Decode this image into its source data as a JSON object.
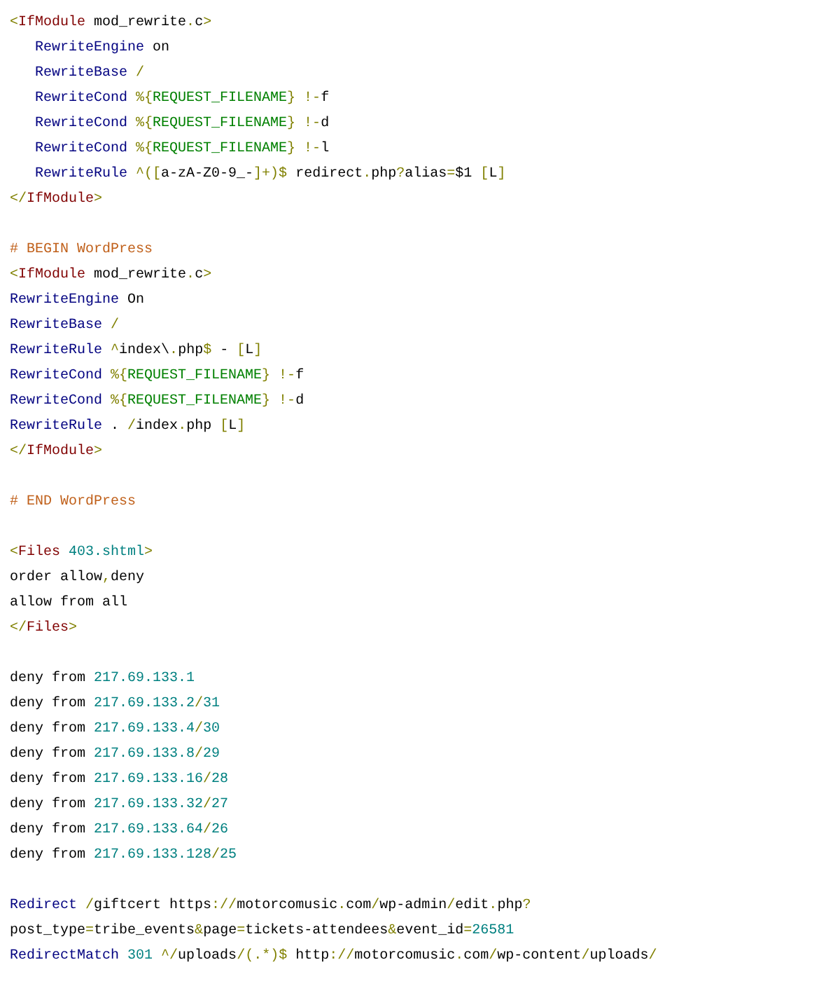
{
  "blocks": [
    {
      "lines": [
        {
          "tokens": [
            {
              "kind": "punct",
              "text": "<"
            },
            {
              "kind": "tag",
              "text": "IfModule"
            },
            {
              "kind": "plain",
              "text": " mod_rewrite"
            },
            {
              "kind": "punct",
              "text": "."
            },
            {
              "kind": "plain",
              "text": "c"
            },
            {
              "kind": "punct",
              "text": ">"
            }
          ],
          "children": [
            {
              "tokens": [
                {
                  "kind": "directive",
                  "text": "RewriteEngine"
                },
                {
                  "kind": "plain",
                  "text": " on"
                }
              ]
            },
            {
              "tokens": [
                {
                  "kind": "directive",
                  "text": "RewriteBase"
                },
                {
                  "kind": "punct",
                  "text": " /"
                }
              ]
            },
            {
              "tokens": [
                {
                  "kind": "directive",
                  "text": "RewriteCond"
                },
                {
                  "kind": "punct",
                  "text": " %{"
                },
                {
                  "kind": "variable",
                  "text": "REQUEST_FILENAME"
                },
                {
                  "kind": "punct",
                  "text": "} !-"
                },
                {
                  "kind": "plain",
                  "text": "f"
                }
              ]
            },
            {
              "tokens": [
                {
                  "kind": "directive",
                  "text": "RewriteCond"
                },
                {
                  "kind": "punct",
                  "text": " %{"
                },
                {
                  "kind": "variable",
                  "text": "REQUEST_FILENAME"
                },
                {
                  "kind": "punct",
                  "text": "} !-"
                },
                {
                  "kind": "plain",
                  "text": "d"
                }
              ]
            },
            {
              "tokens": [
                {
                  "kind": "directive",
                  "text": "RewriteCond"
                },
                {
                  "kind": "punct",
                  "text": " %{"
                },
                {
                  "kind": "variable",
                  "text": "REQUEST_FILENAME"
                },
                {
                  "kind": "punct",
                  "text": "} !-"
                },
                {
                  "kind": "plain",
                  "text": "l"
                }
              ]
            },
            {
              "tokens": [
                {
                  "kind": "directive",
                  "text": "RewriteRule"
                },
                {
                  "kind": "punct",
                  "text": " ^(["
                },
                {
                  "kind": "plain",
                  "text": "a-zA-Z0-9_-"
                },
                {
                  "kind": "punct",
                  "text": "]+)$"
                },
                {
                  "kind": "plain",
                  "text": " redirect"
                },
                {
                  "kind": "punct",
                  "text": "."
                },
                {
                  "kind": "plain",
                  "text": "php"
                },
                {
                  "kind": "punct",
                  "text": "?"
                },
                {
                  "kind": "plain",
                  "text": "alias"
                },
                {
                  "kind": "punct",
                  "text": "="
                },
                {
                  "kind": "plain",
                  "text": "$1"
                },
                {
                  "kind": "punct",
                  "text": " ["
                },
                {
                  "kind": "plain",
                  "text": "L"
                },
                {
                  "kind": "punct",
                  "text": "]"
                }
              ]
            }
          ]
        },
        {
          "tokens": [
            {
              "kind": "punct",
              "text": "</"
            },
            {
              "kind": "tag",
              "text": "IfModule"
            },
            {
              "kind": "punct",
              "text": ">"
            }
          ]
        }
      ]
    },
    {
      "lines": [
        {
          "tokens": [
            {
              "kind": "comment",
              "text": "# BEGIN WordPress"
            }
          ]
        },
        {
          "tokens": [
            {
              "kind": "punct",
              "text": "<"
            },
            {
              "kind": "tag",
              "text": "IfModule"
            },
            {
              "kind": "plain",
              "text": " mod_rewrite"
            },
            {
              "kind": "punct",
              "text": "."
            },
            {
              "kind": "plain",
              "text": "c"
            },
            {
              "kind": "punct",
              "text": ">"
            }
          ]
        },
        {
          "tokens": [
            {
              "kind": "directive",
              "text": "RewriteEngine"
            },
            {
              "kind": "plain",
              "text": " On"
            }
          ]
        },
        {
          "tokens": [
            {
              "kind": "directive",
              "text": "RewriteBase"
            },
            {
              "kind": "punct",
              "text": " /"
            }
          ]
        },
        {
          "tokens": [
            {
              "kind": "directive",
              "text": "RewriteRule"
            },
            {
              "kind": "punct",
              "text": " ^"
            },
            {
              "kind": "plain",
              "text": "index\\"
            },
            {
              "kind": "punct",
              "text": "."
            },
            {
              "kind": "plain",
              "text": "php"
            },
            {
              "kind": "punct",
              "text": "$"
            },
            {
              "kind": "plain",
              "text": " -"
            },
            {
              "kind": "punct",
              "text": " ["
            },
            {
              "kind": "plain",
              "text": "L"
            },
            {
              "kind": "punct",
              "text": "]"
            }
          ]
        },
        {
          "tokens": [
            {
              "kind": "directive",
              "text": "RewriteCond"
            },
            {
              "kind": "punct",
              "text": " %{"
            },
            {
              "kind": "variable",
              "text": "REQUEST_FILENAME"
            },
            {
              "kind": "punct",
              "text": "} !-"
            },
            {
              "kind": "plain",
              "text": "f"
            }
          ]
        },
        {
          "tokens": [
            {
              "kind": "directive",
              "text": "RewriteCond"
            },
            {
              "kind": "punct",
              "text": " %{"
            },
            {
              "kind": "variable",
              "text": "REQUEST_FILENAME"
            },
            {
              "kind": "punct",
              "text": "} !-"
            },
            {
              "kind": "plain",
              "text": "d"
            }
          ]
        },
        {
          "tokens": [
            {
              "kind": "directive",
              "text": "RewriteRule"
            },
            {
              "kind": "plain",
              "text": " ."
            },
            {
              "kind": "punct",
              "text": " /"
            },
            {
              "kind": "plain",
              "text": "index"
            },
            {
              "kind": "punct",
              "text": "."
            },
            {
              "kind": "plain",
              "text": "php"
            },
            {
              "kind": "punct",
              "text": " ["
            },
            {
              "kind": "plain",
              "text": "L"
            },
            {
              "kind": "punct",
              "text": "]"
            }
          ]
        },
        {
          "tokens": [
            {
              "kind": "punct",
              "text": "</"
            },
            {
              "kind": "tag",
              "text": "IfModule"
            },
            {
              "kind": "punct",
              "text": ">"
            }
          ]
        }
      ]
    },
    {
      "lines": [
        {
          "tokens": [
            {
              "kind": "comment",
              "text": "# END WordPress"
            }
          ]
        }
      ]
    },
    {
      "lines": [
        {
          "tokens": [
            {
              "kind": "punct",
              "text": "<"
            },
            {
              "kind": "tag",
              "text": "Files"
            },
            {
              "kind": "number",
              "text": " 403.shtml"
            },
            {
              "kind": "punct",
              "text": ">"
            }
          ]
        },
        {
          "tokens": [
            {
              "kind": "plain",
              "text": "order allow"
            },
            {
              "kind": "punct",
              "text": ","
            },
            {
              "kind": "plain",
              "text": "deny"
            }
          ]
        },
        {
          "tokens": [
            {
              "kind": "plain",
              "text": "allow from all"
            }
          ]
        },
        {
          "tokens": [
            {
              "kind": "punct",
              "text": "</"
            },
            {
              "kind": "tag",
              "text": "Files"
            },
            {
              "kind": "punct",
              "text": ">"
            }
          ]
        }
      ]
    },
    {
      "lines": [
        {
          "tokens": [
            {
              "kind": "plain",
              "text": "deny from"
            },
            {
              "kind": "number",
              "text": " 217.69.133.1"
            }
          ]
        },
        {
          "tokens": [
            {
              "kind": "plain",
              "text": "deny from"
            },
            {
              "kind": "number",
              "text": " 217.69.133.2"
            },
            {
              "kind": "punct",
              "text": "/"
            },
            {
              "kind": "number",
              "text": "31"
            }
          ]
        },
        {
          "tokens": [
            {
              "kind": "plain",
              "text": "deny from"
            },
            {
              "kind": "number",
              "text": " 217.69.133.4"
            },
            {
              "kind": "punct",
              "text": "/"
            },
            {
              "kind": "number",
              "text": "30"
            }
          ]
        },
        {
          "tokens": [
            {
              "kind": "plain",
              "text": "deny from"
            },
            {
              "kind": "number",
              "text": " 217.69.133.8"
            },
            {
              "kind": "punct",
              "text": "/"
            },
            {
              "kind": "number",
              "text": "29"
            }
          ]
        },
        {
          "tokens": [
            {
              "kind": "plain",
              "text": "deny from"
            },
            {
              "kind": "number",
              "text": " 217.69.133.16"
            },
            {
              "kind": "punct",
              "text": "/"
            },
            {
              "kind": "number",
              "text": "28"
            }
          ]
        },
        {
          "tokens": [
            {
              "kind": "plain",
              "text": "deny from"
            },
            {
              "kind": "number",
              "text": " 217.69.133.32"
            },
            {
              "kind": "punct",
              "text": "/"
            },
            {
              "kind": "number",
              "text": "27"
            }
          ]
        },
        {
          "tokens": [
            {
              "kind": "plain",
              "text": "deny from"
            },
            {
              "kind": "number",
              "text": " 217.69.133.64"
            },
            {
              "kind": "punct",
              "text": "/"
            },
            {
              "kind": "number",
              "text": "26"
            }
          ]
        },
        {
          "tokens": [
            {
              "kind": "plain",
              "text": "deny from"
            },
            {
              "kind": "number",
              "text": " 217.69.133.128"
            },
            {
              "kind": "punct",
              "text": "/"
            },
            {
              "kind": "number",
              "text": "25"
            }
          ]
        }
      ]
    },
    {
      "lines": [
        {
          "tokens": [
            {
              "kind": "directive",
              "text": "Redirect"
            },
            {
              "kind": "punct",
              "text": " /"
            },
            {
              "kind": "plain",
              "text": "giftcert https"
            },
            {
              "kind": "punct",
              "text": "://"
            },
            {
              "kind": "plain",
              "text": "motorcomusic"
            },
            {
              "kind": "punct",
              "text": "."
            },
            {
              "kind": "plain",
              "text": "com"
            },
            {
              "kind": "punct",
              "text": "/"
            },
            {
              "kind": "plain",
              "text": "wp-admin"
            },
            {
              "kind": "punct",
              "text": "/"
            },
            {
              "kind": "plain",
              "text": "edit"
            },
            {
              "kind": "punct",
              "text": "."
            },
            {
              "kind": "plain",
              "text": "php"
            },
            {
              "kind": "punct",
              "text": "?"
            }
          ]
        },
        {
          "tokens": [
            {
              "kind": "plain",
              "text": "post_type"
            },
            {
              "kind": "punct",
              "text": "="
            },
            {
              "kind": "plain",
              "text": "tribe_events"
            },
            {
              "kind": "punct",
              "text": "&"
            },
            {
              "kind": "plain",
              "text": "page"
            },
            {
              "kind": "punct",
              "text": "="
            },
            {
              "kind": "plain",
              "text": "tickets-attendees"
            },
            {
              "kind": "punct",
              "text": "&"
            },
            {
              "kind": "plain",
              "text": "event_id"
            },
            {
              "kind": "punct",
              "text": "="
            },
            {
              "kind": "number",
              "text": "26581"
            }
          ]
        },
        {
          "tokens": [
            {
              "kind": "directive",
              "text": "RedirectMatch"
            },
            {
              "kind": "number",
              "text": " 301"
            },
            {
              "kind": "punct",
              "text": " ^/"
            },
            {
              "kind": "plain",
              "text": "uploads"
            },
            {
              "kind": "punct",
              "text": "/(.*)$"
            },
            {
              "kind": "plain",
              "text": " http"
            },
            {
              "kind": "punct",
              "text": "://"
            },
            {
              "kind": "plain",
              "text": "motorcomusic"
            },
            {
              "kind": "punct",
              "text": "."
            },
            {
              "kind": "plain",
              "text": "com"
            },
            {
              "kind": "punct",
              "text": "/"
            },
            {
              "kind": "plain",
              "text": "wp-content"
            },
            {
              "kind": "punct",
              "text": "/"
            },
            {
              "kind": "plain",
              "text": "uploads"
            },
            {
              "kind": "punct",
              "text": "/"
            }
          ]
        }
      ]
    }
  ]
}
